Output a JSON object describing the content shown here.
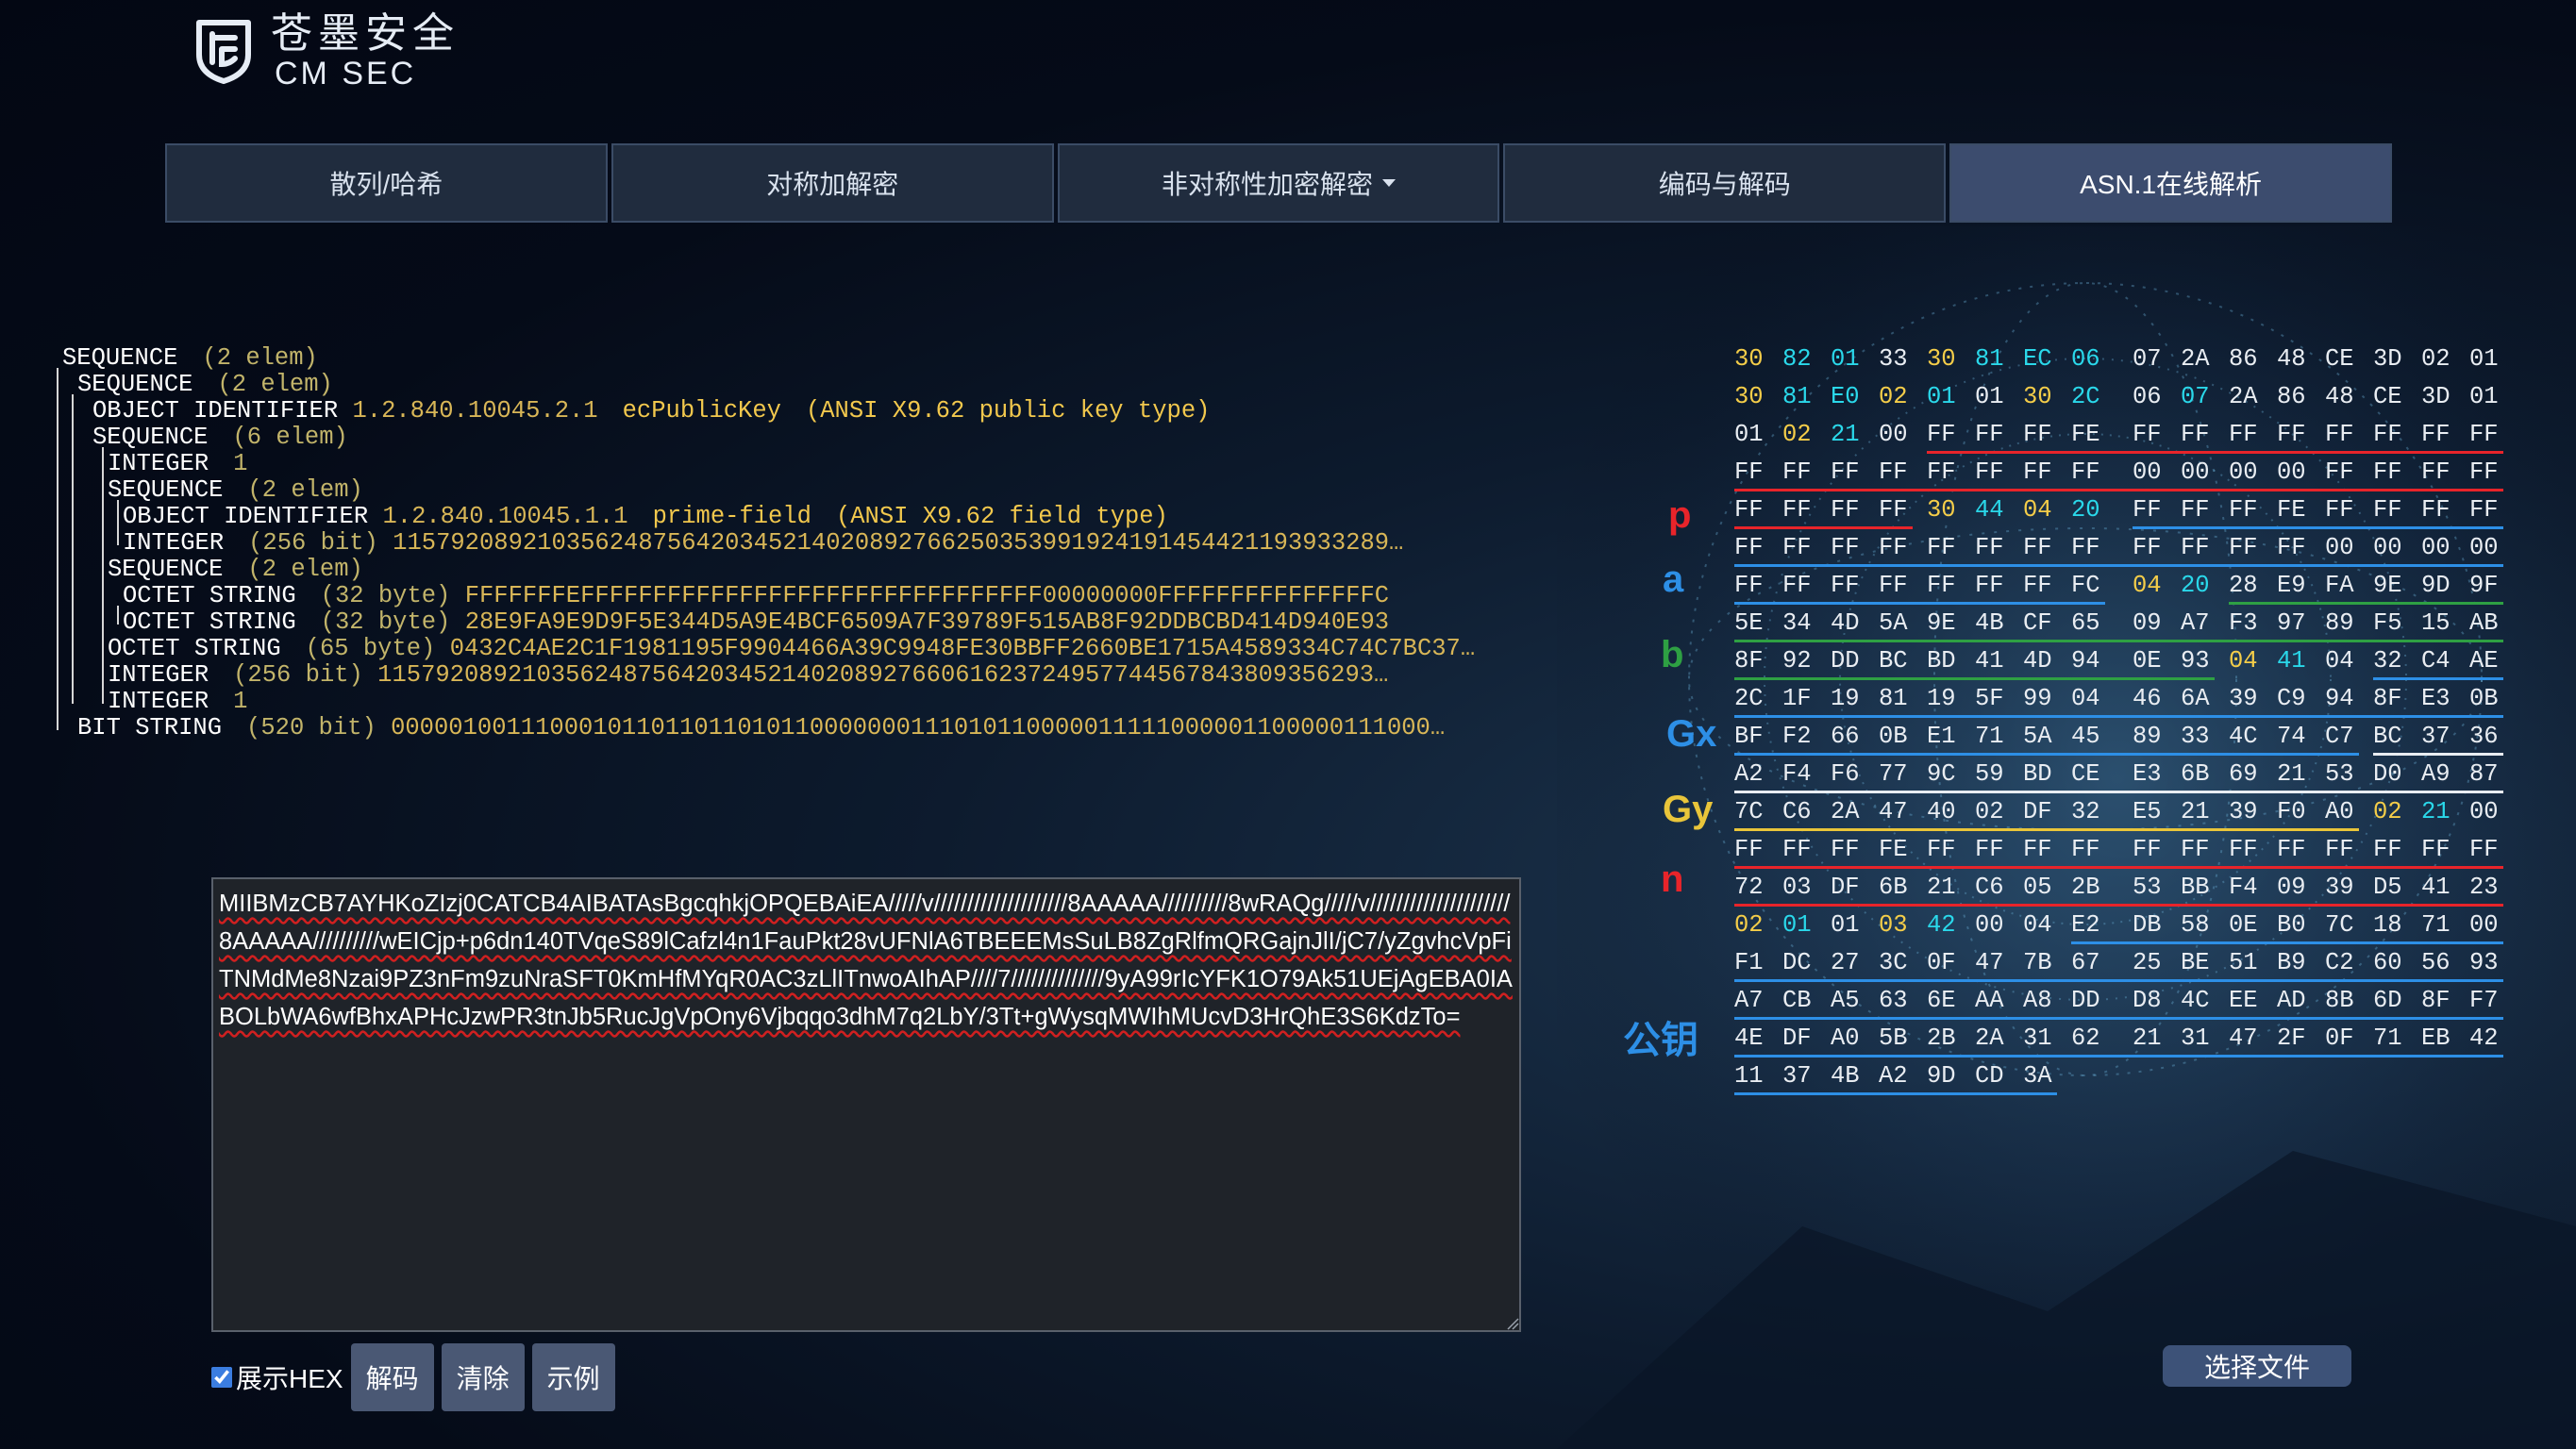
{
  "brand": {
    "name_cn": "苍墨安全",
    "name_en": "CM SEC",
    "logo_icon": "shield-logo-icon"
  },
  "tabs": [
    {
      "label": "散列/哈希",
      "active": false
    },
    {
      "label": "对称加解密",
      "active": false
    },
    {
      "label": "非对称性加密解密",
      "active": false,
      "dropdown": true
    },
    {
      "label": "编码与解码",
      "active": false
    },
    {
      "label": "ASN.1在线解析",
      "active": true
    }
  ],
  "asn_tree": [
    {
      "label": "SEQUENCE",
      "info": "(2 elem)",
      "depth": 0
    },
    {
      "label": "SEQUENCE",
      "info": "(2 elem)",
      "depth": 1
    },
    {
      "label": "OBJECT IDENTIFIER",
      "value": "1.2.840.10045.2.1",
      "name": "ecPublicKey",
      "desc": "(ANSI X9.62 public key type)",
      "depth": 2
    },
    {
      "label": "SEQUENCE",
      "info": "(6 elem)",
      "depth": 2
    },
    {
      "label": "INTEGER",
      "info": "1",
      "depth": 3
    },
    {
      "label": "SEQUENCE",
      "info": "(2 elem)",
      "depth": 3
    },
    {
      "label": "OBJECT IDENTIFIER",
      "value": "1.2.840.10045.1.1",
      "name": "prime-field",
      "desc": "(ANSI X9.62 field type)",
      "depth": 4
    },
    {
      "label": "INTEGER",
      "info": "(256 bit)",
      "value": "115792089210356248756420345214020892766250353991924191454421193933289…",
      "depth": 4
    },
    {
      "label": "SEQUENCE",
      "info": "(2 elem)",
      "depth": 3
    },
    {
      "label": "OCTET STRING",
      "info": "(32 byte)",
      "value": "FFFFFFFEFFFFFFFFFFFFFFFFFFFFFFFFFFFFFFFF00000000FFFFFFFFFFFFFFFC",
      "depth": 4
    },
    {
      "label": "OCTET STRING",
      "info": "(32 byte)",
      "value": "28E9FA9E9D9F5E344D5A9E4BCF6509A7F39789F515AB8F92DDBCBD414D940E93",
      "depth": 4
    },
    {
      "label": "OCTET STRING",
      "info": "(65 byte)",
      "value": "0432C4AE2C1F1981195F9904466A39C9948FE30BBFF2660BE1715A4589334C74C7BC37…",
      "depth": 3
    },
    {
      "label": "INTEGER",
      "info": "(256 bit)",
      "value": "115792089210356248756420345214020892766061623724957744567843809356293…",
      "depth": 3
    },
    {
      "label": "INTEGER",
      "info": "1",
      "depth": 3
    },
    {
      "label": "BIT STRING",
      "info": "(520 bit)",
      "value": "000001001110001011011011010110000000111010110000011111000001100000111000…",
      "depth": 1
    }
  ],
  "hex_rows": [
    "30 82 01 33 30 81 EC 06 07 2A 86 48 CE 3D 02 01",
    "30 81 E0 02 01 01 30 2C 06 07 2A 86 48 CE 3D 01",
    "01 02 21 00 FF FF FF FE FF FF FF FF FF FF FF FF",
    "FF FF FF FF FF FF FF FF 00 00 00 00 FF FF FF FF",
    "FF FF FF FF 30 44 04 20 FF FF FF FE FF FF FF FF",
    "FF FF FF FF FF FF FF FF FF FF FF FF 00 00 00 00",
    "FF FF FF FF FF FF FF FC 04 20 28 E9 FA 9E 9D 9F",
    "5E 34 4D 5A 9E 4B CF 65 09 A7 F3 97 89 F5 15 AB",
    "8F 92 DD BC BD 41 4D 94 0E 93 04 41 04 32 C4 AE",
    "2C 1F 19 81 19 5F 99 04 46 6A 39 C9 94 8F E3 0B",
    "BF F2 66 0B E1 71 5A 45 89 33 4C 74 C7 BC 37 36",
    "A2 F4 F6 77 9C 59 BD CE E3 6B 69 21 53 D0 A9 87",
    "7C C6 2A 47 40 02 DF 32 E5 21 39 F0 A0 02 21 00",
    "FF FF FF FE FF FF FF FF FF FF FF FF FF FF FF FF",
    "72 03 DF 6B 21 C6 05 2B 53 BB F4 09 39 D5 41 23",
    "02 01 01 03 42 00 04 E2 DB 58 0E B0 7C 18 71 00",
    "F1 DC 27 3C 0F 47 7B 67 25 BE 51 B9 C2 60 56 93",
    "A7 CB A5 63 6E AA A8 DD D8 4C EE AD 8B 6D 8F F7",
    "4E DF A0 5B 2B 2A 31 62 21 31 47 2F 0F 71 EB 42",
    "11 37 4B A2 9D CD 3A"
  ],
  "param_labels": [
    {
      "text": "p",
      "color": "#e8242a"
    },
    {
      "text": "a",
      "color": "#2d8fe6"
    },
    {
      "text": "b",
      "color": "#2ea043"
    },
    {
      "text": "Gx",
      "color": "#2d8fe6"
    },
    {
      "text": "Gy",
      "color": "#e9c53a"
    },
    {
      "text": "n",
      "color": "#e8242a"
    },
    {
      "text": "公钥",
      "color": "#2d8fe6"
    }
  ],
  "input_text": "MIIBMzCB7AYHKoZIzj0CATCB4AIBATAsBgcqhkjOPQEBAiEA/////v////////////////////8AAAAA//////////8wRAQg/////v/////////////////////8AAAAA//////////wEICjp+p6dn140TVqeS89lCafzl4n1FauPkt28vUFNlA6TBEEEMsSuLB8ZgRlfmQRGajnJlI/jC7/yZgvhcVpFiTNMdMe8Nzai9PZ3nFm9zuNraSFT0KmHfMYqR0AC3zLlITnwoAIhAP////7//////////////9yA99rIcYFK1O79Ak51UEjAgEBA0IABOLbWA6wfBhxAPHcJzwPR3tnJb5RucJgVpOny6Vjbqqo3dhM7q2LbY/3Tt+gWysqMWIhMUcvD3HrQhE3S6KdzTo=",
  "controls": {
    "show_hex_label": "展示HEX",
    "show_hex_checked": true,
    "decode_label": "解码",
    "clear_label": "清除",
    "example_label": "示例",
    "file_label": "选择文件"
  },
  "colors": {
    "tag": "#f4cd49",
    "length": "#2ad8ea",
    "underline_blue": "#2d8fe6",
    "underline_red": "#e8242a",
    "underline_green": "#2ea043",
    "underline_yellow": "#e9c53a",
    "underline_white": "#e9edf2",
    "active_tab": "#3c4c6e"
  }
}
